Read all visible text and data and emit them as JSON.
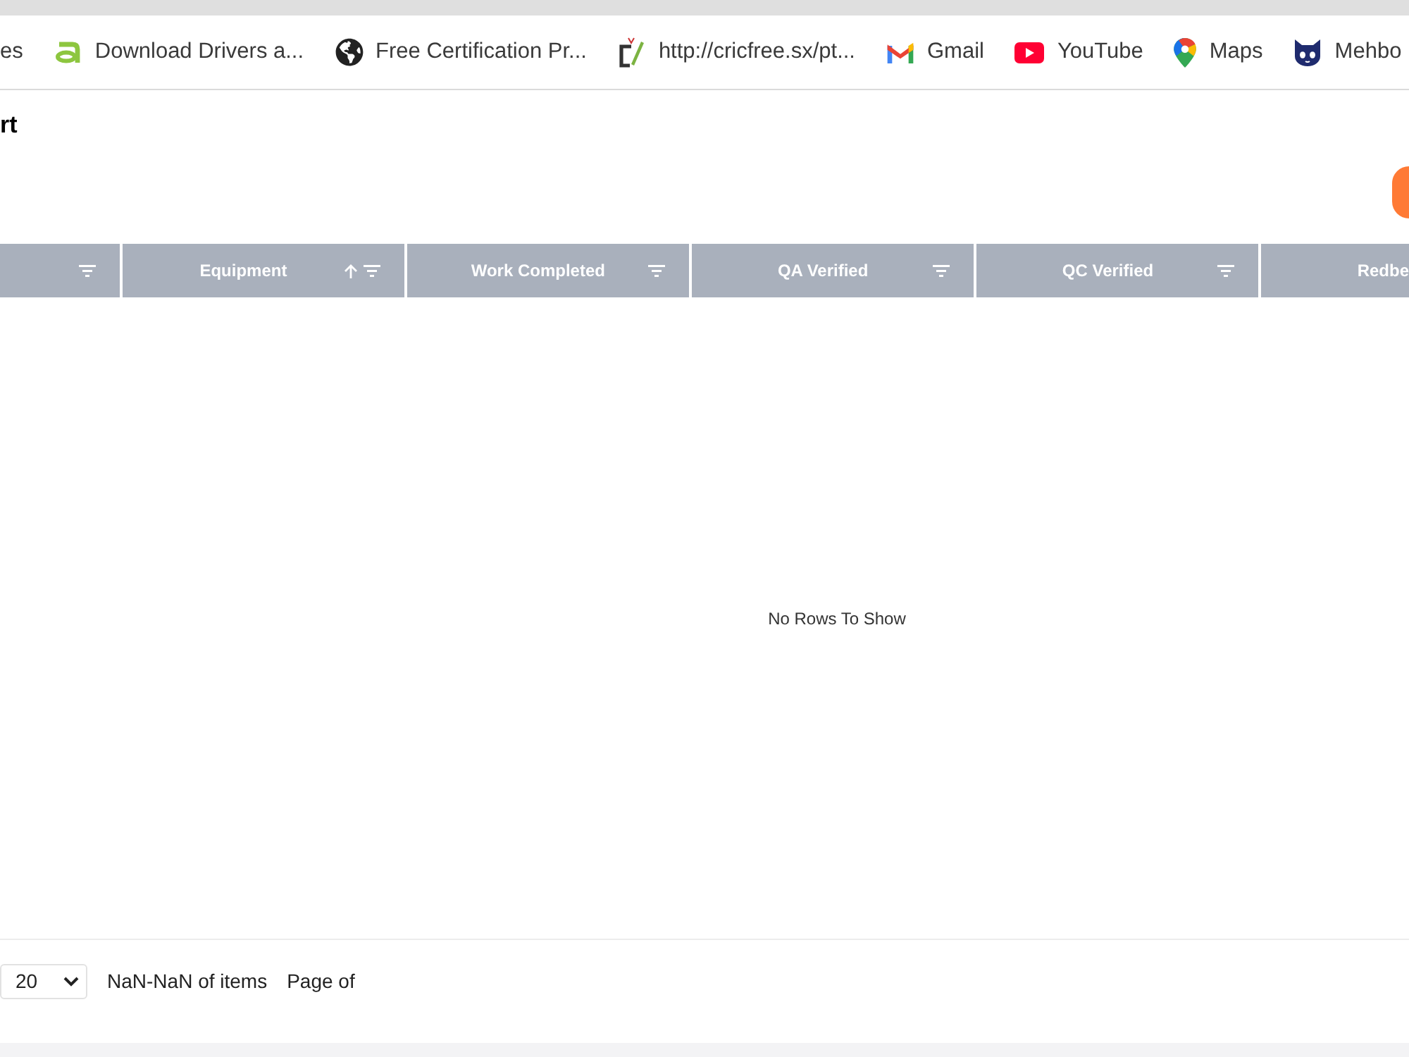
{
  "bookmarks_bar": {
    "items": [
      {
        "label": "es"
      },
      {
        "label": "Download Drivers a..."
      },
      {
        "label": "Free Certification Pr..."
      },
      {
        "label": "http://cricfree.sx/pt..."
      },
      {
        "label": "Gmail"
      },
      {
        "label": "YouTube"
      },
      {
        "label": "Maps"
      },
      {
        "label": "Mehbo"
      }
    ]
  },
  "page": {
    "title": "rt"
  },
  "table": {
    "columns": [
      {
        "sorted_ascending": false,
        "filter": true
      },
      {
        "label": "Equipment",
        "sorted_ascending": true,
        "filter": true
      },
      {
        "label": "Work Completed",
        "sorted_ascending": false,
        "filter": true
      },
      {
        "label": "QA Verified",
        "sorted_ascending": false,
        "filter": true
      },
      {
        "label": "QC Verified",
        "sorted_ascending": false,
        "filter": true
      },
      {
        "label": "Redbe",
        "sorted_ascending": false,
        "filter": false
      }
    ],
    "empty_message": "No Rows To Show"
  },
  "pagination": {
    "page_size": "20",
    "range": "NaN-NaN of items",
    "page": "Page of"
  }
}
